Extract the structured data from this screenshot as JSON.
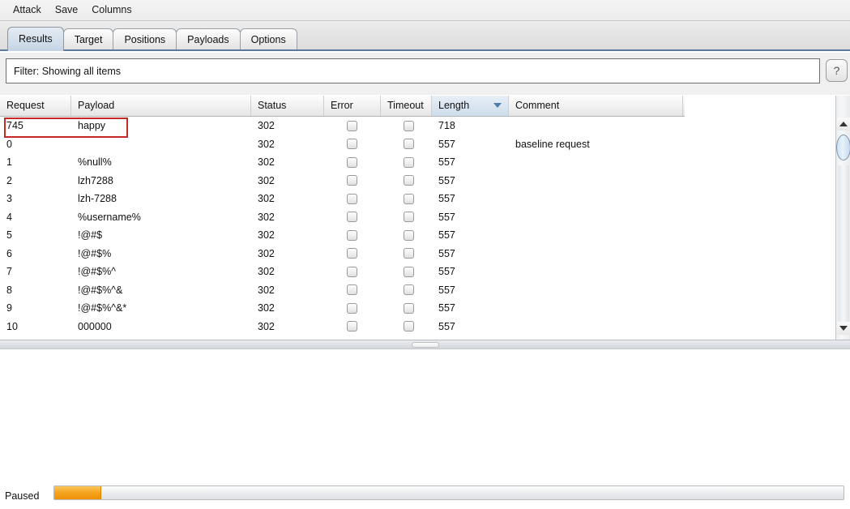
{
  "menubar": {
    "items": [
      {
        "label": "Attack"
      },
      {
        "label": "Save"
      },
      {
        "label": "Columns"
      }
    ]
  },
  "tabs": [
    {
      "label": "Results",
      "active": true
    },
    {
      "label": "Target",
      "active": false
    },
    {
      "label": "Positions",
      "active": false
    },
    {
      "label": "Payloads",
      "active": false
    },
    {
      "label": "Options",
      "active": false
    }
  ],
  "filter": {
    "label": "Filter:  Showing all items",
    "help_icon": "question-mark-icon",
    "help_label": "?"
  },
  "table": {
    "columns": [
      {
        "label": "Request",
        "key": "request",
        "sorted": false
      },
      {
        "label": "Payload",
        "key": "payload",
        "sorted": false
      },
      {
        "label": "Status",
        "key": "status",
        "sorted": false
      },
      {
        "label": "Error",
        "key": "error",
        "sorted": false
      },
      {
        "label": "Timeout",
        "key": "timeout",
        "sorted": false
      },
      {
        "label": "Length",
        "key": "length",
        "sorted": true,
        "sort_direction": "descending"
      },
      {
        "label": "Comment",
        "key": "comment",
        "sorted": false
      }
    ],
    "rows": [
      {
        "request": "745",
        "payload": "happy",
        "status": "302",
        "error": false,
        "timeout": false,
        "length": "718",
        "comment": "",
        "highlighted": true
      },
      {
        "request": "0",
        "payload": "",
        "status": "302",
        "error": false,
        "timeout": false,
        "length": "557",
        "comment": "baseline request",
        "highlighted": false
      },
      {
        "request": "1",
        "payload": "%null%",
        "status": "302",
        "error": false,
        "timeout": false,
        "length": "557",
        "comment": "",
        "highlighted": false
      },
      {
        "request": "2",
        "payload": "lzh7288",
        "status": "302",
        "error": false,
        "timeout": false,
        "length": "557",
        "comment": "",
        "highlighted": false
      },
      {
        "request": "3",
        "payload": "lzh-7288",
        "status": "302",
        "error": false,
        "timeout": false,
        "length": "557",
        "comment": "",
        "highlighted": false
      },
      {
        "request": "4",
        "payload": "%username%",
        "status": "302",
        "error": false,
        "timeout": false,
        "length": "557",
        "comment": "",
        "highlighted": false
      },
      {
        "request": "5",
        "payload": "!@#$",
        "status": "302",
        "error": false,
        "timeout": false,
        "length": "557",
        "comment": "",
        "highlighted": false
      },
      {
        "request": "6",
        "payload": "!@#$%",
        "status": "302",
        "error": false,
        "timeout": false,
        "length": "557",
        "comment": "",
        "highlighted": false
      },
      {
        "request": "7",
        "payload": "!@#$%^",
        "status": "302",
        "error": false,
        "timeout": false,
        "length": "557",
        "comment": "",
        "highlighted": false
      },
      {
        "request": "8",
        "payload": "!@#$%^&",
        "status": "302",
        "error": false,
        "timeout": false,
        "length": "557",
        "comment": "",
        "highlighted": false
      },
      {
        "request": "9",
        "payload": "!@#$%^&*",
        "status": "302",
        "error": false,
        "timeout": false,
        "length": "557",
        "comment": "",
        "highlighted": false
      },
      {
        "request": "10",
        "payload": "000000",
        "status": "302",
        "error": false,
        "timeout": false,
        "length": "557",
        "comment": "",
        "highlighted": false
      }
    ]
  },
  "scrollbar": {
    "up_icon": "triangle-up-icon",
    "down_icon": "triangle-down-icon"
  },
  "statusbar": {
    "state_label": "Paused",
    "progress_percent": 6
  },
  "colors": {
    "annotation_red": "#c62828",
    "progress_orange": "#f5a623",
    "sort_arrow_blue": "#4f7ca8",
    "active_tab_blue": "#d3dfec"
  }
}
